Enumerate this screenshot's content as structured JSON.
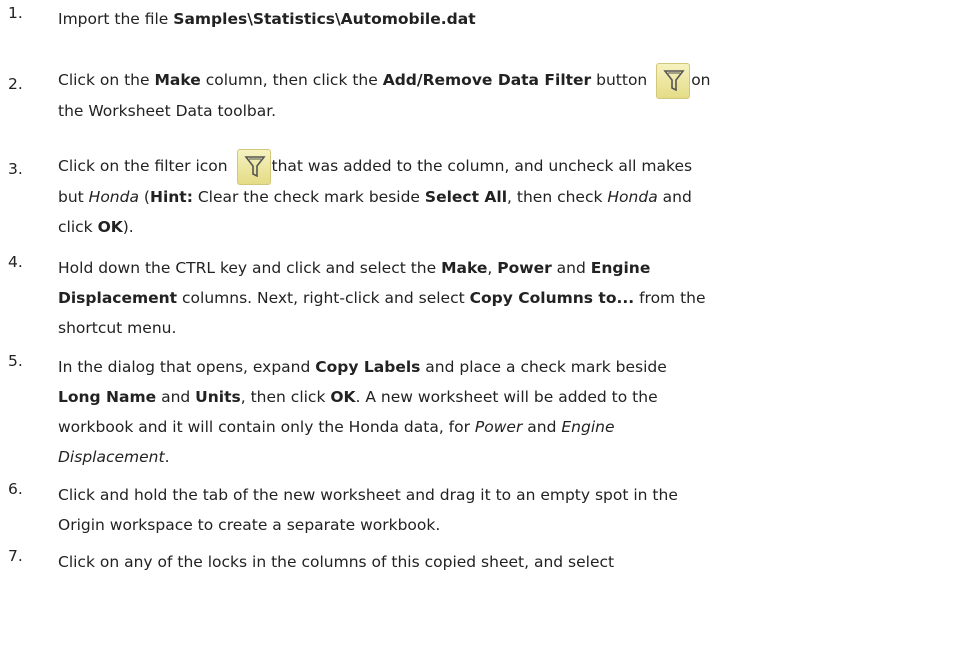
{
  "steps": [
    {
      "n": "1.",
      "a": "Import the file ",
      "b": "Samples\\Statistics\\Automobile.dat"
    },
    {
      "n": "2.",
      "a": "Click on the ",
      "b": "Make",
      "c": " column, then click the ",
      "d": "Add/Remove Data Filter",
      "e": " button ",
      "f": "on",
      "g": "the Worksheet Data toolbar."
    },
    {
      "n": "3.",
      "a": "Click on the filter icon ",
      "b": "that was added to the column, and uncheck all makes",
      "c": "but ",
      "d": "Honda",
      "e": " (",
      "f": "Hint:",
      "g": " Clear the check mark beside ",
      "h": "Select All",
      "i": ", then check ",
      "j": "Honda",
      "k": " and",
      "l": "click ",
      "m": "OK",
      "o": ")."
    },
    {
      "n": "4.",
      "a": "Hold down the CTRL key and click and select the ",
      "b": "Make",
      "c": ", ",
      "d": "Power",
      "e": " and ",
      "f": "Engine",
      "g": "Displacement",
      "h": " columns. Next, right-click and select ",
      "i": "Copy Columns to...",
      "j": " from the",
      "k": "shortcut menu."
    },
    {
      "n": "5.",
      "a": "In the dialog that opens, expand ",
      "b": "Copy Labels",
      "c": " and place a check mark beside",
      "d": "Long Name",
      "e": " and ",
      "f": "Units",
      "g": ", then click ",
      "h": "OK",
      "i": ". A new worksheet will be added to the",
      "j": "workbook and it will contain only the Honda data, for ",
      "k": "Power",
      "l": " and ",
      "m": "Engine",
      "o": "Displacement",
      "p": "."
    },
    {
      "n": "6.",
      "a": "Click and hold the tab of the new worksheet and drag it to an empty spot in the",
      "b": "Origin workspace to create a separate workbook."
    },
    {
      "n": "7.",
      "a": "Click on any of the locks in the columns of this copied sheet, and select"
    }
  ],
  "icons": {
    "filter": "filter-funnel-icon",
    "button_bg": "#efe8a8",
    "funnel_stroke": "#555555"
  }
}
